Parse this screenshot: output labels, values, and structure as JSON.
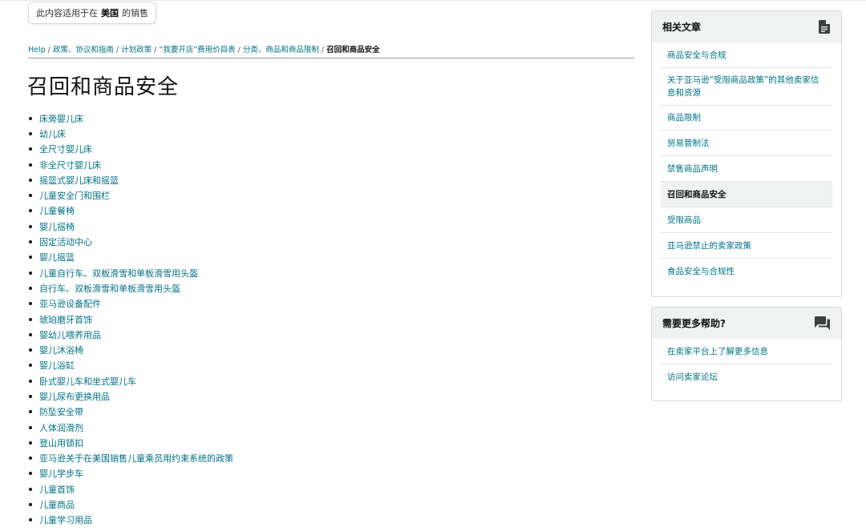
{
  "region_notice": {
    "prefix": "此内容适用于在",
    "country": "美国",
    "suffix": "的销售"
  },
  "breadcrumb": [
    {
      "label": "Help",
      "link": true
    },
    {
      "label": "政策、协议和指南",
      "link": true
    },
    {
      "label": "计划政策",
      "link": true
    },
    {
      "label": "“我要开店”费用价目表",
      "link": true
    },
    {
      "label": "分类、商品和商品限制",
      "link": true
    },
    {
      "label": "召回和商品安全",
      "link": false
    }
  ],
  "breadcrumb_separator": "/",
  "page_title": "召回和商品安全",
  "topics": [
    "床旁婴儿床",
    "幼儿床",
    "全尺寸婴儿床",
    "非全尺寸婴儿床",
    "摇篮式婴儿床和摇篮",
    "儿童安全门和围栏",
    "儿童餐椅",
    "婴儿摇椅",
    "固定活动中心",
    "婴儿摇篮",
    "儿童自行车、双板滑雪和单板滑雪用头盔",
    "自行车、双板滑雪和单板滑雪用头盔",
    "亚马逊设备配件",
    "琥珀磨牙首饰",
    "婴幼儿喂养用品",
    "婴儿沐浴椅",
    "婴儿浴缸",
    "卧式婴儿车和坐式婴儿车",
    "婴儿尿布更换用品",
    "防坠安全带",
    "人体润滑剂",
    "登山用锁扣",
    "亚马逊关于在美国销售儿童乘员用约束系统的政策",
    "婴儿学步车",
    "儿童首饰",
    "儿童商品",
    "儿童学习用品"
  ],
  "related_articles": {
    "title": "相关文章",
    "icon": "document-icon",
    "items": [
      {
        "label": "商品安全与合规",
        "active": false
      },
      {
        "label": "关于亚马逊“受限商品政策”的其他卖家信息和资源",
        "active": false
      },
      {
        "label": "商品限制",
        "active": false
      },
      {
        "label": "贸易管制法",
        "active": false
      },
      {
        "label": "禁售商品声明",
        "active": false
      },
      {
        "label": "召回和商品安全",
        "active": true
      },
      {
        "label": "受限商品",
        "active": false
      },
      {
        "label": "亚马逊禁止的卖家政策",
        "active": false
      },
      {
        "label": "食品安全与合规性",
        "active": false
      }
    ]
  },
  "more_help": {
    "title": "需要更多帮助?",
    "icon": "chat-icon",
    "items": [
      {
        "label": "在卖家平台上了解更多信息"
      },
      {
        "label": "访问卖家论坛"
      }
    ]
  },
  "colors": {
    "link": "#007185",
    "text": "#0F1111",
    "panel_header_bg": "#f0f2f2",
    "border": "#d5d9d9"
  }
}
